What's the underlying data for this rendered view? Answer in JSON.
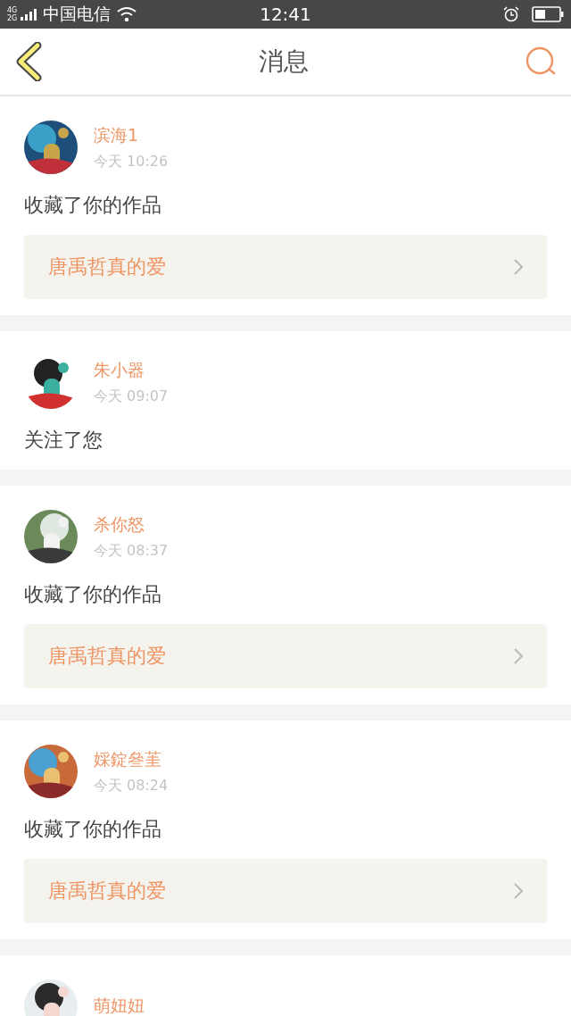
{
  "status_bar": {
    "network_top": "4G",
    "network_bottom": "2G",
    "carrier": "中国电信",
    "time": "12:41"
  },
  "header": {
    "title": "消息"
  },
  "messages": [
    {
      "name": "滨海1",
      "time": "今天 10:26",
      "action": "收藏了你的作品",
      "work": "唐禹哲真的爱"
    },
    {
      "name": "朱小器",
      "time": "今天 09:07",
      "action": "关注了您"
    },
    {
      "name": "杀你怒",
      "time": "今天 08:37",
      "action": "收藏了你的作品",
      "work": "唐禹哲真的爱"
    },
    {
      "name": "婇錠叄茥",
      "time": "今天 08:24",
      "action": "收藏了你的作品",
      "work": "唐禹哲真的爱"
    },
    {
      "name": "萌妞妞"
    }
  ]
}
